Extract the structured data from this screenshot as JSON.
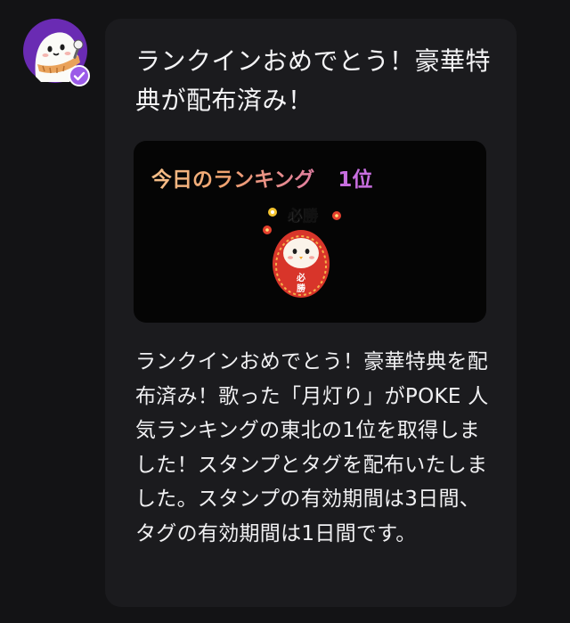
{
  "message": {
    "title": "ランクインおめでとう！豪華特典が配布済み！",
    "ranking_label": "今日のランキング",
    "ranking_position": "1位",
    "sticker_text": "必勝",
    "body": "ランクインおめでとう！豪華特典を配布済み！歌った「月灯り」がPOKE 人気ランキングの東北の1位を取得しました！スタンプとタグを配布いたしました。スタンプの有効期間は3日間、タグの有効期間は1日間です。"
  },
  "sender": {
    "avatar_icon": "ghost-mascot-avatar",
    "badge_icon": "verified-check-icon"
  },
  "colors": {
    "page_bg": "#131315",
    "bubble_bg": "#1b1b1e",
    "card_bg": "#050505",
    "avatar_ring": "#6a2bb3",
    "ranking_label_start": "#f6c08a",
    "ranking_label_end": "#e07ea0",
    "ranking_position": "#c86ee0",
    "daruma_red": "#d8352a"
  }
}
